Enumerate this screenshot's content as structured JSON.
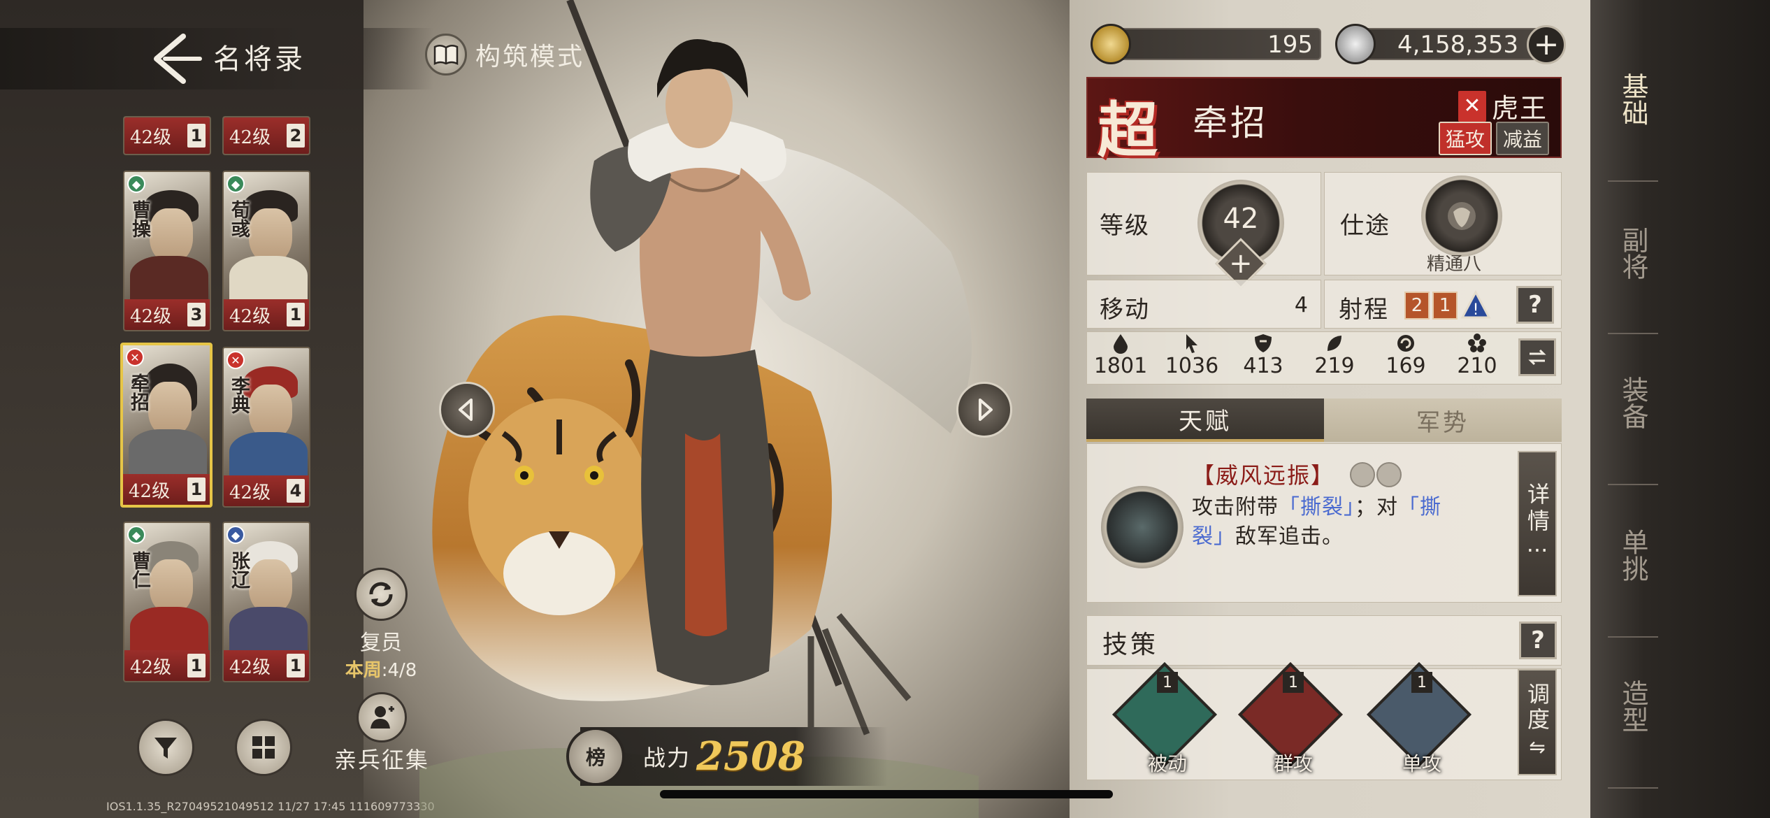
{
  "header": {
    "title": "名将录",
    "build_mode": "构筑模式"
  },
  "currency": {
    "gold": "195",
    "silver": "4,158,353"
  },
  "cards_top": [
    {
      "level": "42",
      "unit": "级",
      "count": "1"
    },
    {
      "level": "42",
      "unit": "级",
      "count": "2"
    }
  ],
  "cards": [
    {
      "name": "曹操",
      "level": "42",
      "unit": "级",
      "count": "3",
      "faction": "green"
    },
    {
      "name": "荀彧",
      "level": "42",
      "unit": "级",
      "count": "1",
      "faction": "green"
    },
    {
      "name": "牵招",
      "level": "42",
      "unit": "级",
      "count": "1",
      "faction": "red",
      "selected": true
    },
    {
      "name": "李典",
      "level": "42",
      "unit": "级",
      "count": "4",
      "faction": "red"
    },
    {
      "name": "曹仁",
      "level": "42",
      "unit": "级",
      "count": "1",
      "faction": "green"
    },
    {
      "name": "张辽",
      "level": "42",
      "unit": "级",
      "count": "1",
      "faction": "blue"
    }
  ],
  "reset": {
    "label": "复员",
    "week_label": "本周",
    "week_value": ":4/8"
  },
  "recruit": {
    "label": "亲兵征集"
  },
  "version": "IOS1.1.35_R27049521049512 11/27 17:45 111609773330",
  "power": {
    "emblem": "榜",
    "label": "战力",
    "value": "2508"
  },
  "hero": {
    "rank": "超",
    "name": "牵招",
    "tag": "虎王",
    "badges": [
      "猛攻",
      "减益"
    ],
    "level_label": "等级",
    "level": "42",
    "career_label": "仕途",
    "career_sub": "精通八",
    "move_label": "移动",
    "move_value": "4",
    "range_label": "射程",
    "range_values": [
      "2",
      "1"
    ],
    "help": "?",
    "attributes": [
      {
        "icon": "drop-icon",
        "value": "1801"
      },
      {
        "icon": "cursor-icon",
        "value": "1036"
      },
      {
        "icon": "shield-icon",
        "value": "413"
      },
      {
        "icon": "leaf-icon",
        "value": "219"
      },
      {
        "icon": "swirl-icon",
        "value": "169"
      },
      {
        "icon": "flower-icon",
        "value": "210"
      }
    ]
  },
  "tabs": {
    "talent": "天赋",
    "momentum": "军势"
  },
  "talent": {
    "name": "【威风远振】",
    "desc_1": "攻击附带",
    "kw_1": "「撕裂」",
    "desc_2": "；对",
    "kw_2a": "「撕",
    "kw_2b": "裂」",
    "desc_3": "敌军追击。",
    "detail_btn": "详情"
  },
  "skills": {
    "title": "技策",
    "items": [
      {
        "label": "被动",
        "count": "1",
        "color": "#2f6a5a"
      },
      {
        "label": "群攻",
        "count": "1",
        "color": "#7a2a26"
      },
      {
        "label": "单攻",
        "count": "1",
        "color": "#4a5a6a"
      }
    ],
    "adjust_btn": "调度"
  },
  "nav": [
    "基础",
    "副将",
    "装备",
    "单挑",
    "造型"
  ],
  "colors": {
    "accent_gold": "#f0c85a",
    "header_red": "#5c1614",
    "link_blue": "#4a6ad0"
  }
}
